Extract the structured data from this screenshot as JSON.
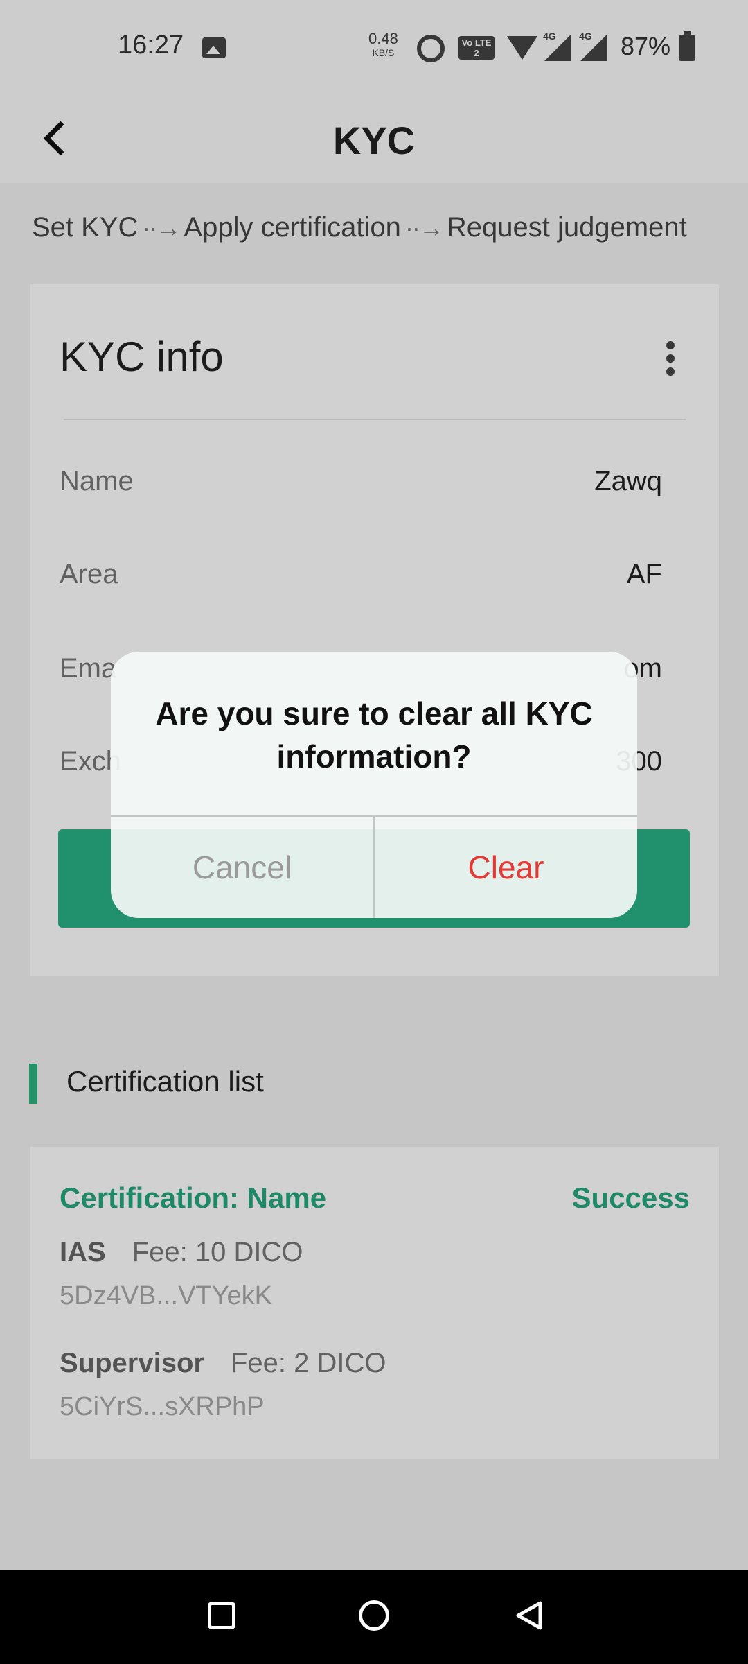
{
  "status_bar": {
    "time": "16:27",
    "net_speed": "0.48",
    "net_speed_unit": "KB/S",
    "volte_label": "Vo LTE 2",
    "signal_1_label": "4G",
    "signal_2_label": "4G",
    "battery": "87%",
    "icons": [
      "gallery-icon",
      "alarm-icon",
      "volte-icon",
      "wifi-icon",
      "signal-icon",
      "signal-icon",
      "battery-icon"
    ]
  },
  "header": {
    "title": "KYC",
    "back_icon": "back-chevron-icon"
  },
  "steps": [
    "Set KYC",
    "Apply certification",
    "Request judgement"
  ],
  "kyc_card": {
    "title": "KYC info",
    "more_icon": "more-vertical-icon",
    "rows": [
      {
        "label": "Name",
        "value": "Zawq"
      },
      {
        "label": "Area",
        "value": "AF"
      },
      {
        "label": "Ema",
        "value": "om"
      },
      {
        "label": "Exch",
        "value": "300"
      }
    ]
  },
  "certification": {
    "section_title": "Certification list",
    "card_title": "Certification: Name",
    "status": "Success",
    "entries": [
      {
        "who": "IAS",
        "fee": "Fee: 10 DICO",
        "address": "5Dz4VB...VTYekK"
      },
      {
        "who": "Supervisor",
        "fee": "Fee: 2 DICO",
        "address": "5CiYrS...sXRPhP"
      }
    ]
  },
  "dialog": {
    "message": "Are you sure to clear all KYC information?",
    "cancel_label": "Cancel",
    "clear_label": "Clear"
  },
  "colors": {
    "accent_green": "#29b085",
    "danger_red": "#e53935"
  }
}
